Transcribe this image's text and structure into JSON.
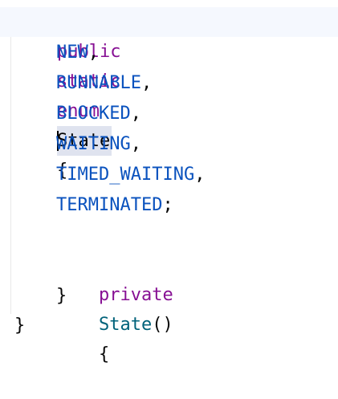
{
  "editor": {
    "lines": {
      "decl": {
        "kw1": "public",
        "kw2": "static",
        "kw3": "enum",
        "name": "State",
        "brace": "{"
      },
      "c1": {
        "name": "NEW",
        "punct": ","
      },
      "c2": {
        "name": "RUNNABLE",
        "punct": ","
      },
      "c3": {
        "name": "BLOCKED",
        "punct": ","
      },
      "c4": {
        "name": "WAITING",
        "punct": ","
      },
      "c5": {
        "name": "TIMED_WAITING",
        "punct": ","
      },
      "c6": {
        "name": "TERMINATED",
        "punct": ";"
      },
      "ctor": {
        "kw": "private",
        "name": "State",
        "parens": "()",
        "brace": "{"
      },
      "ctor_close": {
        "brace": "}"
      },
      "close": {
        "brace": "}"
      }
    }
  },
  "colors": {
    "keyword": "#871094",
    "enum_constant": "#0a52be",
    "constructor": "#00627a",
    "selection": "#dfe3ef",
    "current_line": "#f5f8fe"
  }
}
